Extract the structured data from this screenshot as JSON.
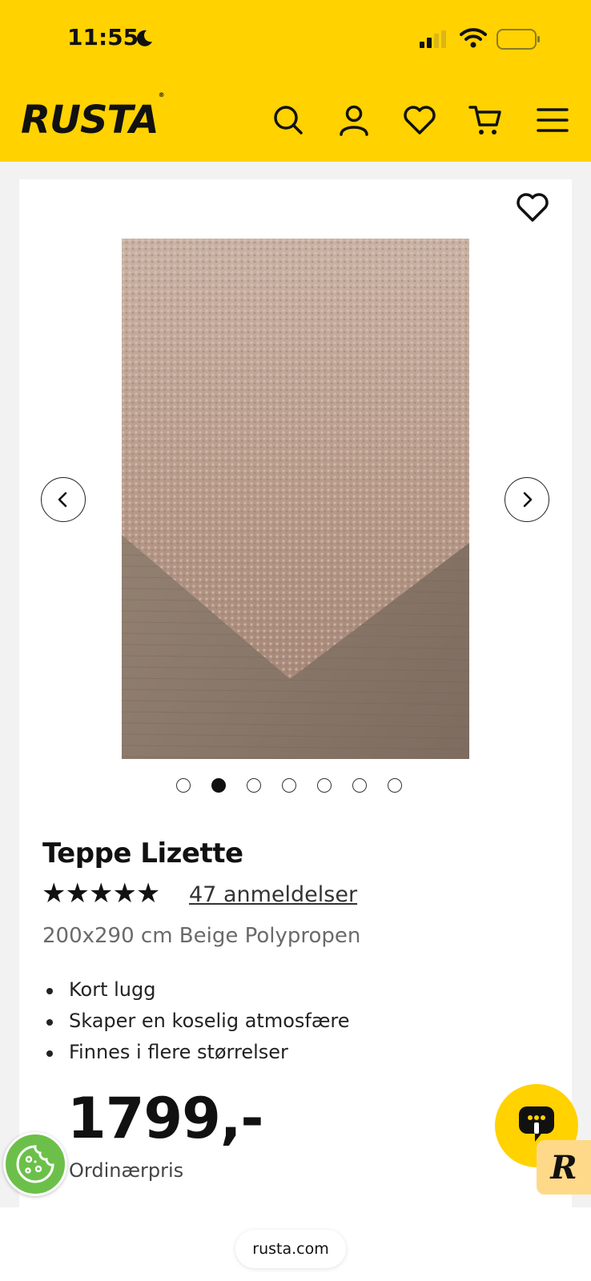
{
  "status_bar": {
    "time": "11:55"
  },
  "header": {
    "logo": "RUSTA",
    "logo_mark": "®"
  },
  "product": {
    "title": "Teppe Lizette",
    "rating": 5,
    "stars": "★★★★★",
    "reviews_link": "47 anmeldelser",
    "subtitle": "200x290 cm Beige Polypropen",
    "features": [
      "Kort lugg",
      "Skaper en koselig atmosfære",
      "Finnes i flere størrelser"
    ],
    "price": "1799,-",
    "price_label": "Ordinærpris"
  },
  "carousel": {
    "total_images": 7,
    "active_index": 1
  },
  "browser": {
    "url": "rusta.com"
  },
  "colors": {
    "brand_yellow": "#ffd200",
    "cookie_green": "#6cc04a",
    "badge_peach": "#ffd98a"
  },
  "icons": [
    "moon-icon",
    "signal-icon",
    "wifi-icon",
    "battery-icon",
    "search-icon",
    "user-icon",
    "heart-icon",
    "cart-icon",
    "menu-icon",
    "chevron-left-icon",
    "chevron-right-icon",
    "cookie-icon",
    "chat-bot-icon"
  ]
}
